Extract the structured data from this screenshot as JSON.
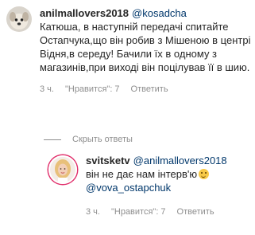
{
  "comments": [
    {
      "username": "anilmallovers2018",
      "mention": "@kosadcha",
      "text": "Катюша, в наступній передачі спитайте Остапчука,що він робив з Мішеною в центрі Відня,в середу! Бачили їх в одному з магазинів,при виході він поцілував її в шию.",
      "time": "3 ч.",
      "likes": "\"Нравится\": 7",
      "reply": "Ответить"
    },
    {
      "username": "svitsketv",
      "mention": "@anilmallovers2018",
      "text": "він не дає нам інтерв'ю",
      "emoji": "slightly-smiling-face-icon",
      "mention2": "@vova_ostapchuk",
      "time": "3 ч.",
      "likes": "\"Нравится\": 7",
      "reply": "Ответить"
    }
  ],
  "hide_replies": "Скрыть ответы",
  "colors": {
    "text": "#262626",
    "meta": "#8e8e8e",
    "mention": "#00376b",
    "story_ring": "#e1306c"
  }
}
